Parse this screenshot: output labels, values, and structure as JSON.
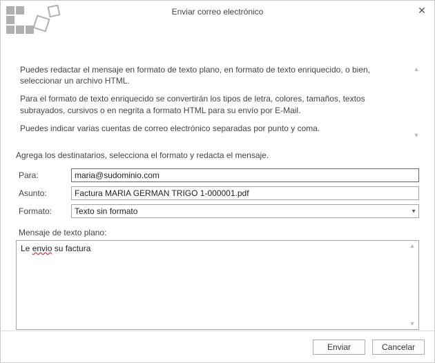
{
  "window": {
    "title": "Enviar correo electrónico"
  },
  "intro": {
    "p1": "Puedes redactar el mensaje en formato de texto plano, en formato de texto enriquecido, o bien, seleccionar un archivo HTML.",
    "p2": "Para el formato de texto enriquecido se convertirán los tipos de letra, colores, tamaños, textos subrayados, cursivos o en negrita a formato HTML para su envío por E-Mail.",
    "p3": "Puedes indicar varias cuentas de correo electrónico separadas por punto y coma."
  },
  "instruction": "Agrega los destinatarios, selecciona el formato y redacta el mensaje.",
  "form": {
    "para_label": "Para:",
    "para_value": "maria@sudominio.com",
    "asunto_label": "Asunto:",
    "asunto_value": "Factura MARIA GERMAN TRIGO 1-000001.pdf",
    "formato_label": "Formato:",
    "formato_value": "Texto sin formato"
  },
  "message": {
    "label": "Mensaje de texto plano:",
    "text_pre": "Le ",
    "text_misspell": "envio",
    "text_post": " su factura"
  },
  "buttons": {
    "send": "Enviar",
    "cancel": "Cancelar"
  }
}
